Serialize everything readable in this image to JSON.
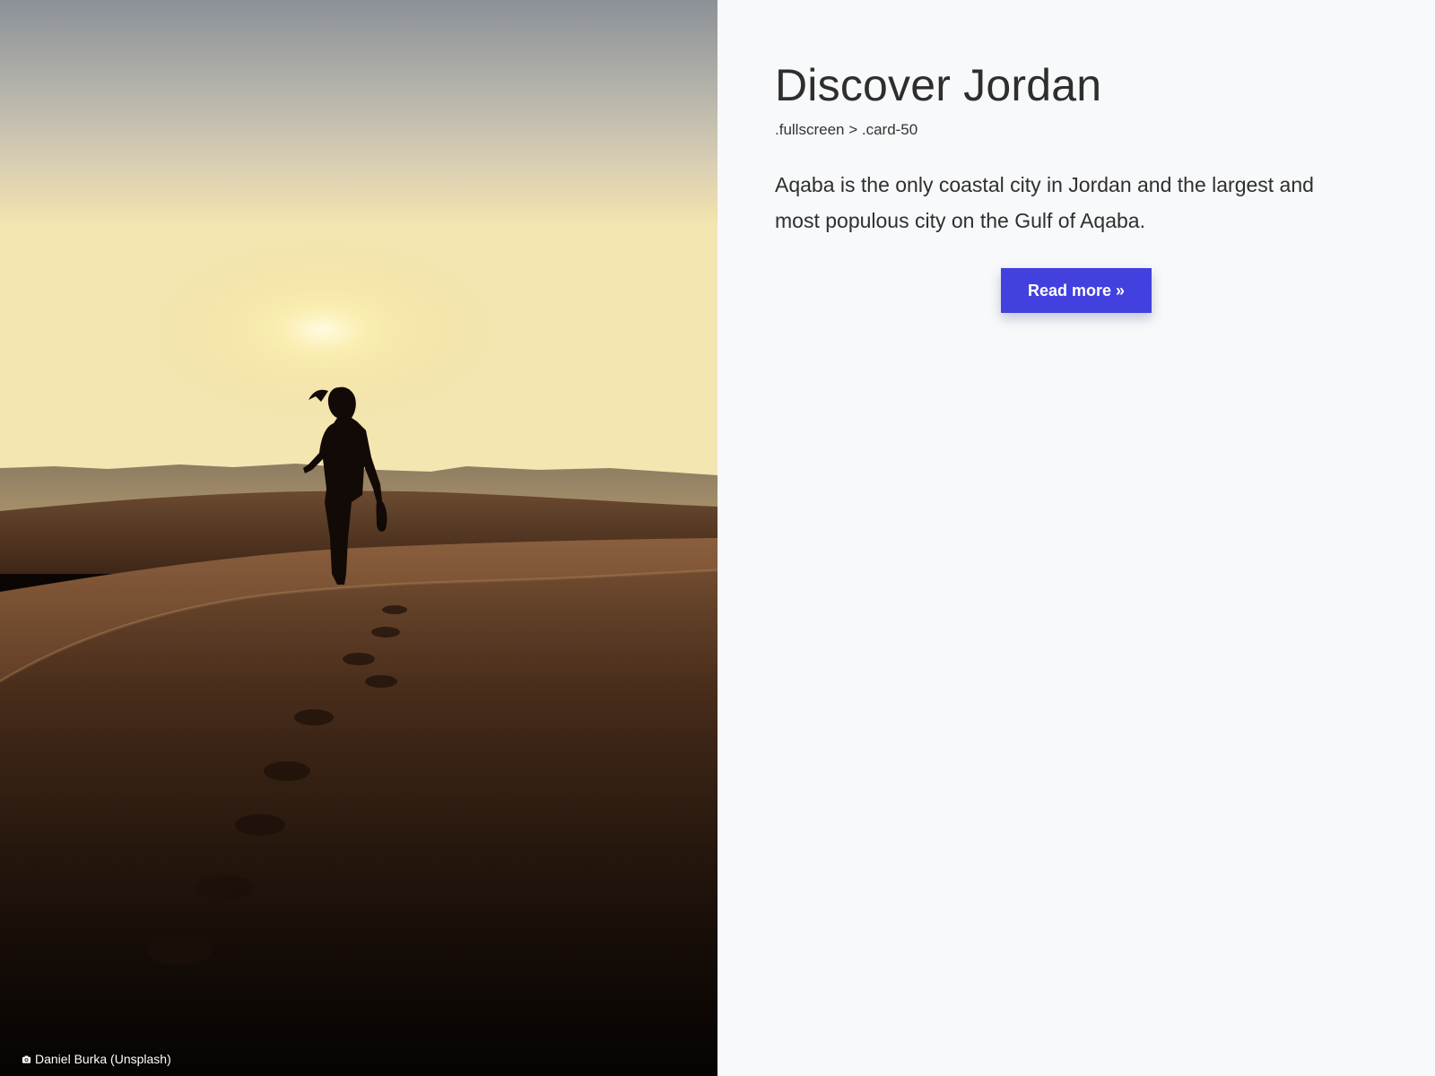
{
  "hero": {
    "image_alt": "Woman silhouetted on a desert sand dune at sunset",
    "credit": {
      "icon": "camera-icon",
      "text": "Daniel Burka (Unsplash)"
    }
  },
  "content": {
    "title": "Discover Jordan",
    "selector": ".fullscreen > .card-50",
    "description": "Aqaba is the only coastal city in Jordan and the largest and most populous city on the Gulf of Aqaba.",
    "button_label": "Read more »"
  },
  "colors": {
    "accent": "#4240de",
    "panel_background": "#f8f9fa",
    "text": "#2e2e2e"
  }
}
